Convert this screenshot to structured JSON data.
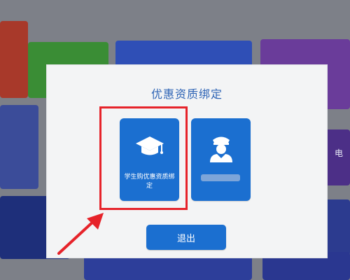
{
  "dialog": {
    "title": "优惠资质绑定",
    "options": [
      {
        "label": "学生购优惠资质绑定",
        "icon": "graduation-cap-icon"
      },
      {
        "label": "",
        "icon": "officer-icon"
      }
    ],
    "exit_label": "退出"
  },
  "background": {
    "side_text": "电"
  },
  "colors": {
    "dialog_bg": "#f3f4f5",
    "title": "#2d63b5",
    "card_blue": "#1b6fd0",
    "highlight_red": "#e6232a"
  }
}
